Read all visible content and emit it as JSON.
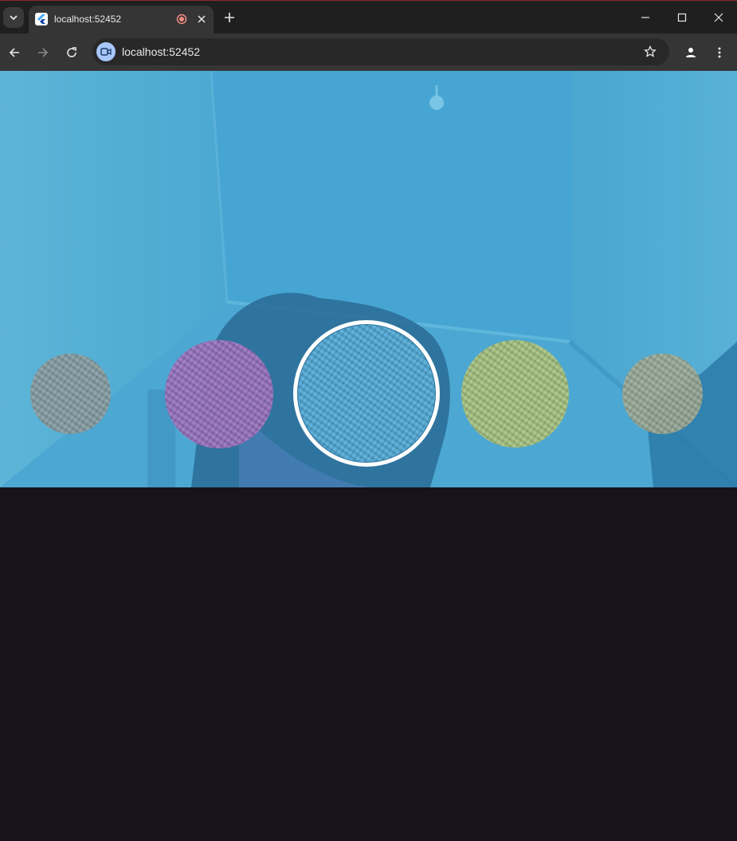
{
  "browser": {
    "tab": {
      "title": "localhost:52452",
      "favicon": "flutter-icon",
      "recording_indicator": "record-icon"
    },
    "address_bar": {
      "url": "localhost:52452",
      "site_icon": "video-camera-icon"
    },
    "colors": {
      "tabstrip": "#1f1f1f",
      "toolbar": "#353535",
      "omnibox": "#282828",
      "site_chip": "#a8c7fa"
    }
  },
  "camera_view": {
    "active_tint": "#4ba4cf",
    "filters": [
      {
        "name": "grey",
        "color": "#8a9a9c",
        "selected": false
      },
      {
        "name": "purple",
        "color": "#9a6fbe",
        "selected": false
      },
      {
        "name": "blue",
        "color": "#4fa8d6",
        "selected": true
      },
      {
        "name": "yellow-green",
        "color": "#a9c27a",
        "selected": false
      },
      {
        "name": "olive",
        "color": "#9fa890",
        "selected": false
      }
    ]
  },
  "page_background": "#16131b"
}
